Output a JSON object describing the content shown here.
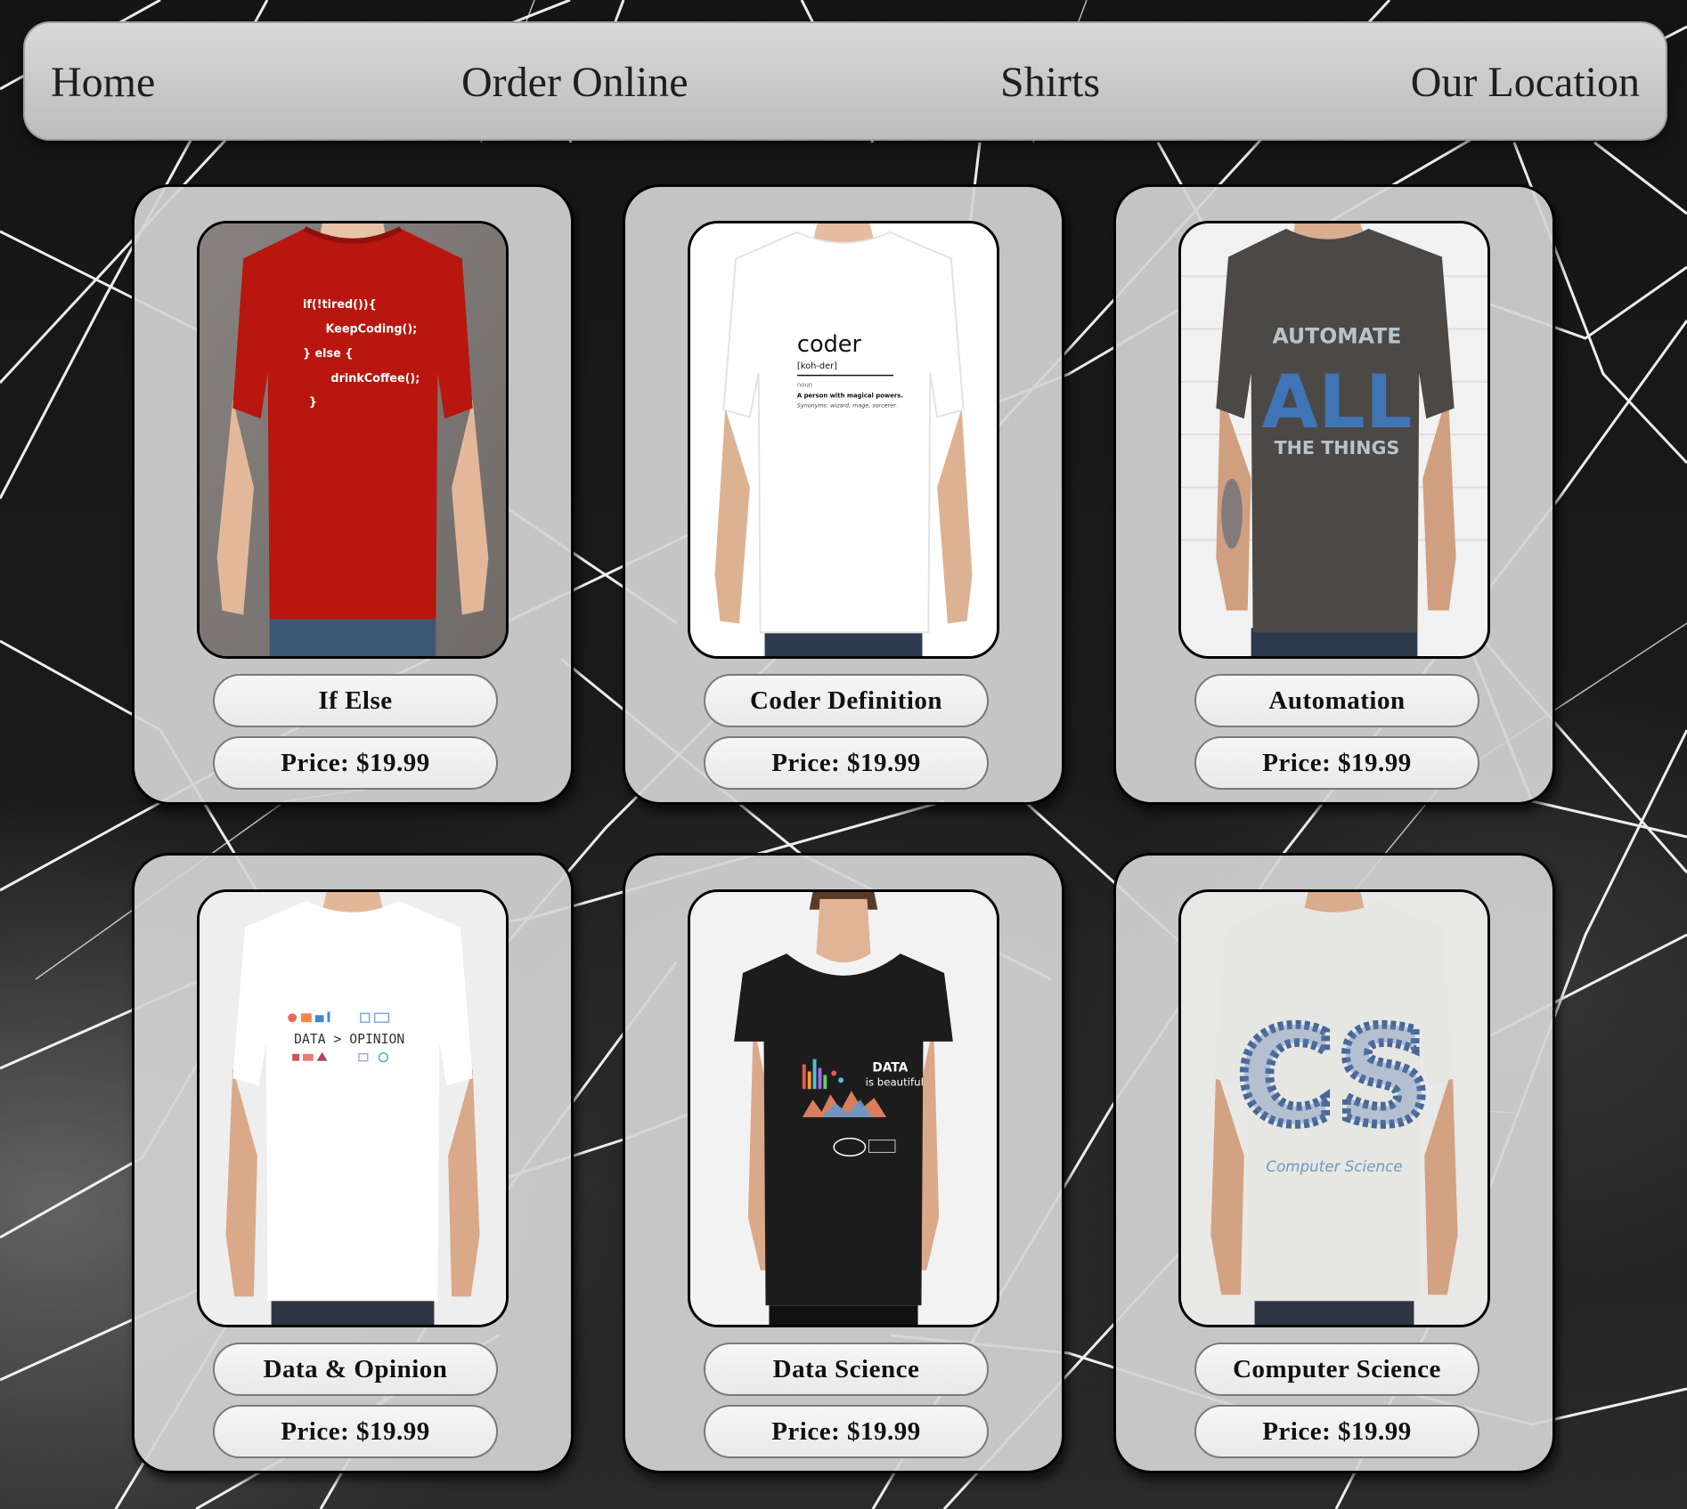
{
  "nav": {
    "home": "Home",
    "order_online": "Order Online",
    "shirts": "Shirts",
    "our_location": "Our Location"
  },
  "products": [
    {
      "name": "If Else",
      "price": "Price: $19.99",
      "shirt_color": "#b8160e",
      "print": [
        "if(!tired()){",
        "KeepCoding();",
        "} else {",
        "drinkCoffee();",
        "}"
      ]
    },
    {
      "name": "Coder Definition",
      "price": "Price: $19.99",
      "shirt_color": "#ffffff",
      "print": [
        "coder",
        "[koh-der]",
        "noun",
        "A person with magical powers.",
        "Synonyms: wizard, mage, sorcerer."
      ]
    },
    {
      "name": "Automation",
      "price": "Price: $19.99",
      "shirt_color": "#4b4846",
      "print": [
        "AUTOMATE",
        "ALL",
        "THE THINGS"
      ]
    },
    {
      "name": "Data & Opinion",
      "price": "Price: $19.99",
      "shirt_color": "#ffffff",
      "print": [
        "DATA > OPINION"
      ]
    },
    {
      "name": "Data Science",
      "price": "Price: $19.99",
      "shirt_color": "#1c1c1c",
      "print": [
        "DATA",
        "is beautiful"
      ]
    },
    {
      "name": "Computer Science",
      "price": "Price: $19.99",
      "shirt_color": "#e6e6e2",
      "print": [
        "CS",
        "Computer Science"
      ]
    }
  ]
}
